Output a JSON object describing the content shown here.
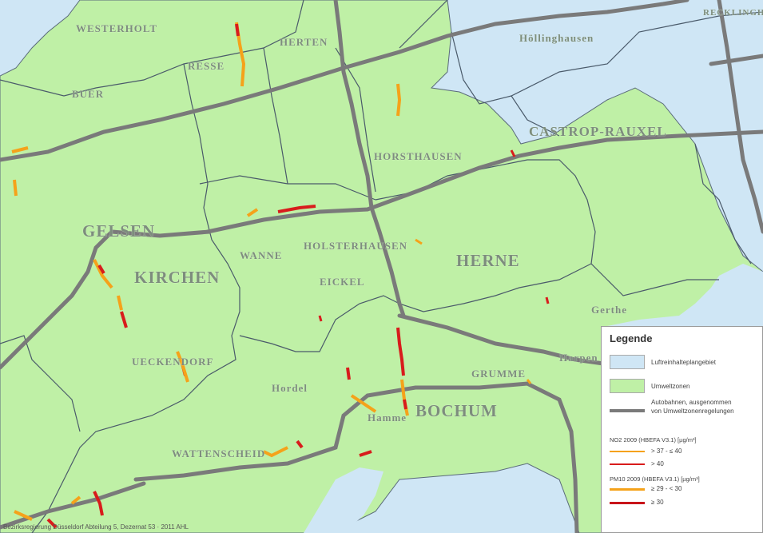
{
  "map": {
    "colors": {
      "water_bg": "#cfe6f5",
      "umweltzone": "#bff0a6",
      "autobahn": "#7a7a7a",
      "no2_low": "#f5a21a",
      "no2_high": "#d81c1c",
      "pm10_low": "#f5a21a",
      "pm10_high": "#c8141a"
    },
    "places": {
      "westerholt": "WESTERHOLT",
      "herten": "HERTEN",
      "buer": "BUER",
      "resse": "RESSE",
      "gelsen": "GELSEN",
      "kirchen": "KIRCHEN",
      "herne": "HERNE",
      "bochum": "BOCHUM",
      "castrop": "CASTROP-RAUXEL",
      "horsthausen": "HORSTHAUSEN",
      "hoelkeskampen": "HOLSTERHAUSEN",
      "recklinghausen": "RECKLINGHAUSEN",
      "hollinghausen": "Höllinghausen",
      "eickel": "EICKEL",
      "wanne": "WANNE",
      "gerthe": "Gerthe",
      "harpen": "Harpen",
      "grumme": "GRUMME",
      "hordel": "Hordel",
      "hamme": "Hamme",
      "wattenscheid": "WATTENSCHEID",
      "ueckendorf": "UECKENDORF"
    },
    "credit": "Bezirksregierung Düsseldorf  Abteilung 5, Dezernat 53 · 2011 AHL"
  },
  "legend": {
    "title": "Legende",
    "items": {
      "lrp": "Luftreinhalteplangebiet",
      "uz": "Umweltzonen",
      "ab_line1": "Autobahnen, ausgenommen",
      "ab_line2": "von Umweltzonenregelungen"
    },
    "no2_header": "NO2 2009 (HBEFA V3.1) [µg/m³]",
    "no2_low": "> 37 - ≤ 40",
    "no2_high": "> 40",
    "pm10_header": "PM10 2009 (HBEFA V3.1) [µg/m³]",
    "pm10_low": "≥ 29 - < 30",
    "pm10_high": "≥ 30"
  }
}
